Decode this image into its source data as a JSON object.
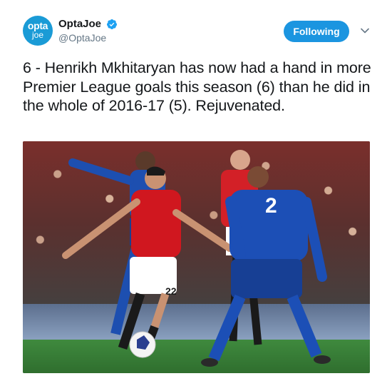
{
  "account": {
    "avatar_line1": "opta",
    "avatar_line2": "joe",
    "display_name": "OptaJoe",
    "handle": "@OptaJoe"
  },
  "actions": {
    "follow_label": "Following"
  },
  "tweet": {
    "text": "6 - Henrikh Mkhitaryan has now had a hand in more Premier League goals this season (6) than he did in the whole of 2016-17 (5). Rejuvenated."
  },
  "photo": {
    "shirt_number_blue": "2",
    "shirt_number_red": "22"
  },
  "colors": {
    "accent": "#1b95e0",
    "avatar": "#1a9bd6",
    "text": "#14171a",
    "secondary_text": "#657786"
  },
  "icons": {
    "verified": "verified-badge-icon",
    "more": "chevron-down-icon"
  }
}
